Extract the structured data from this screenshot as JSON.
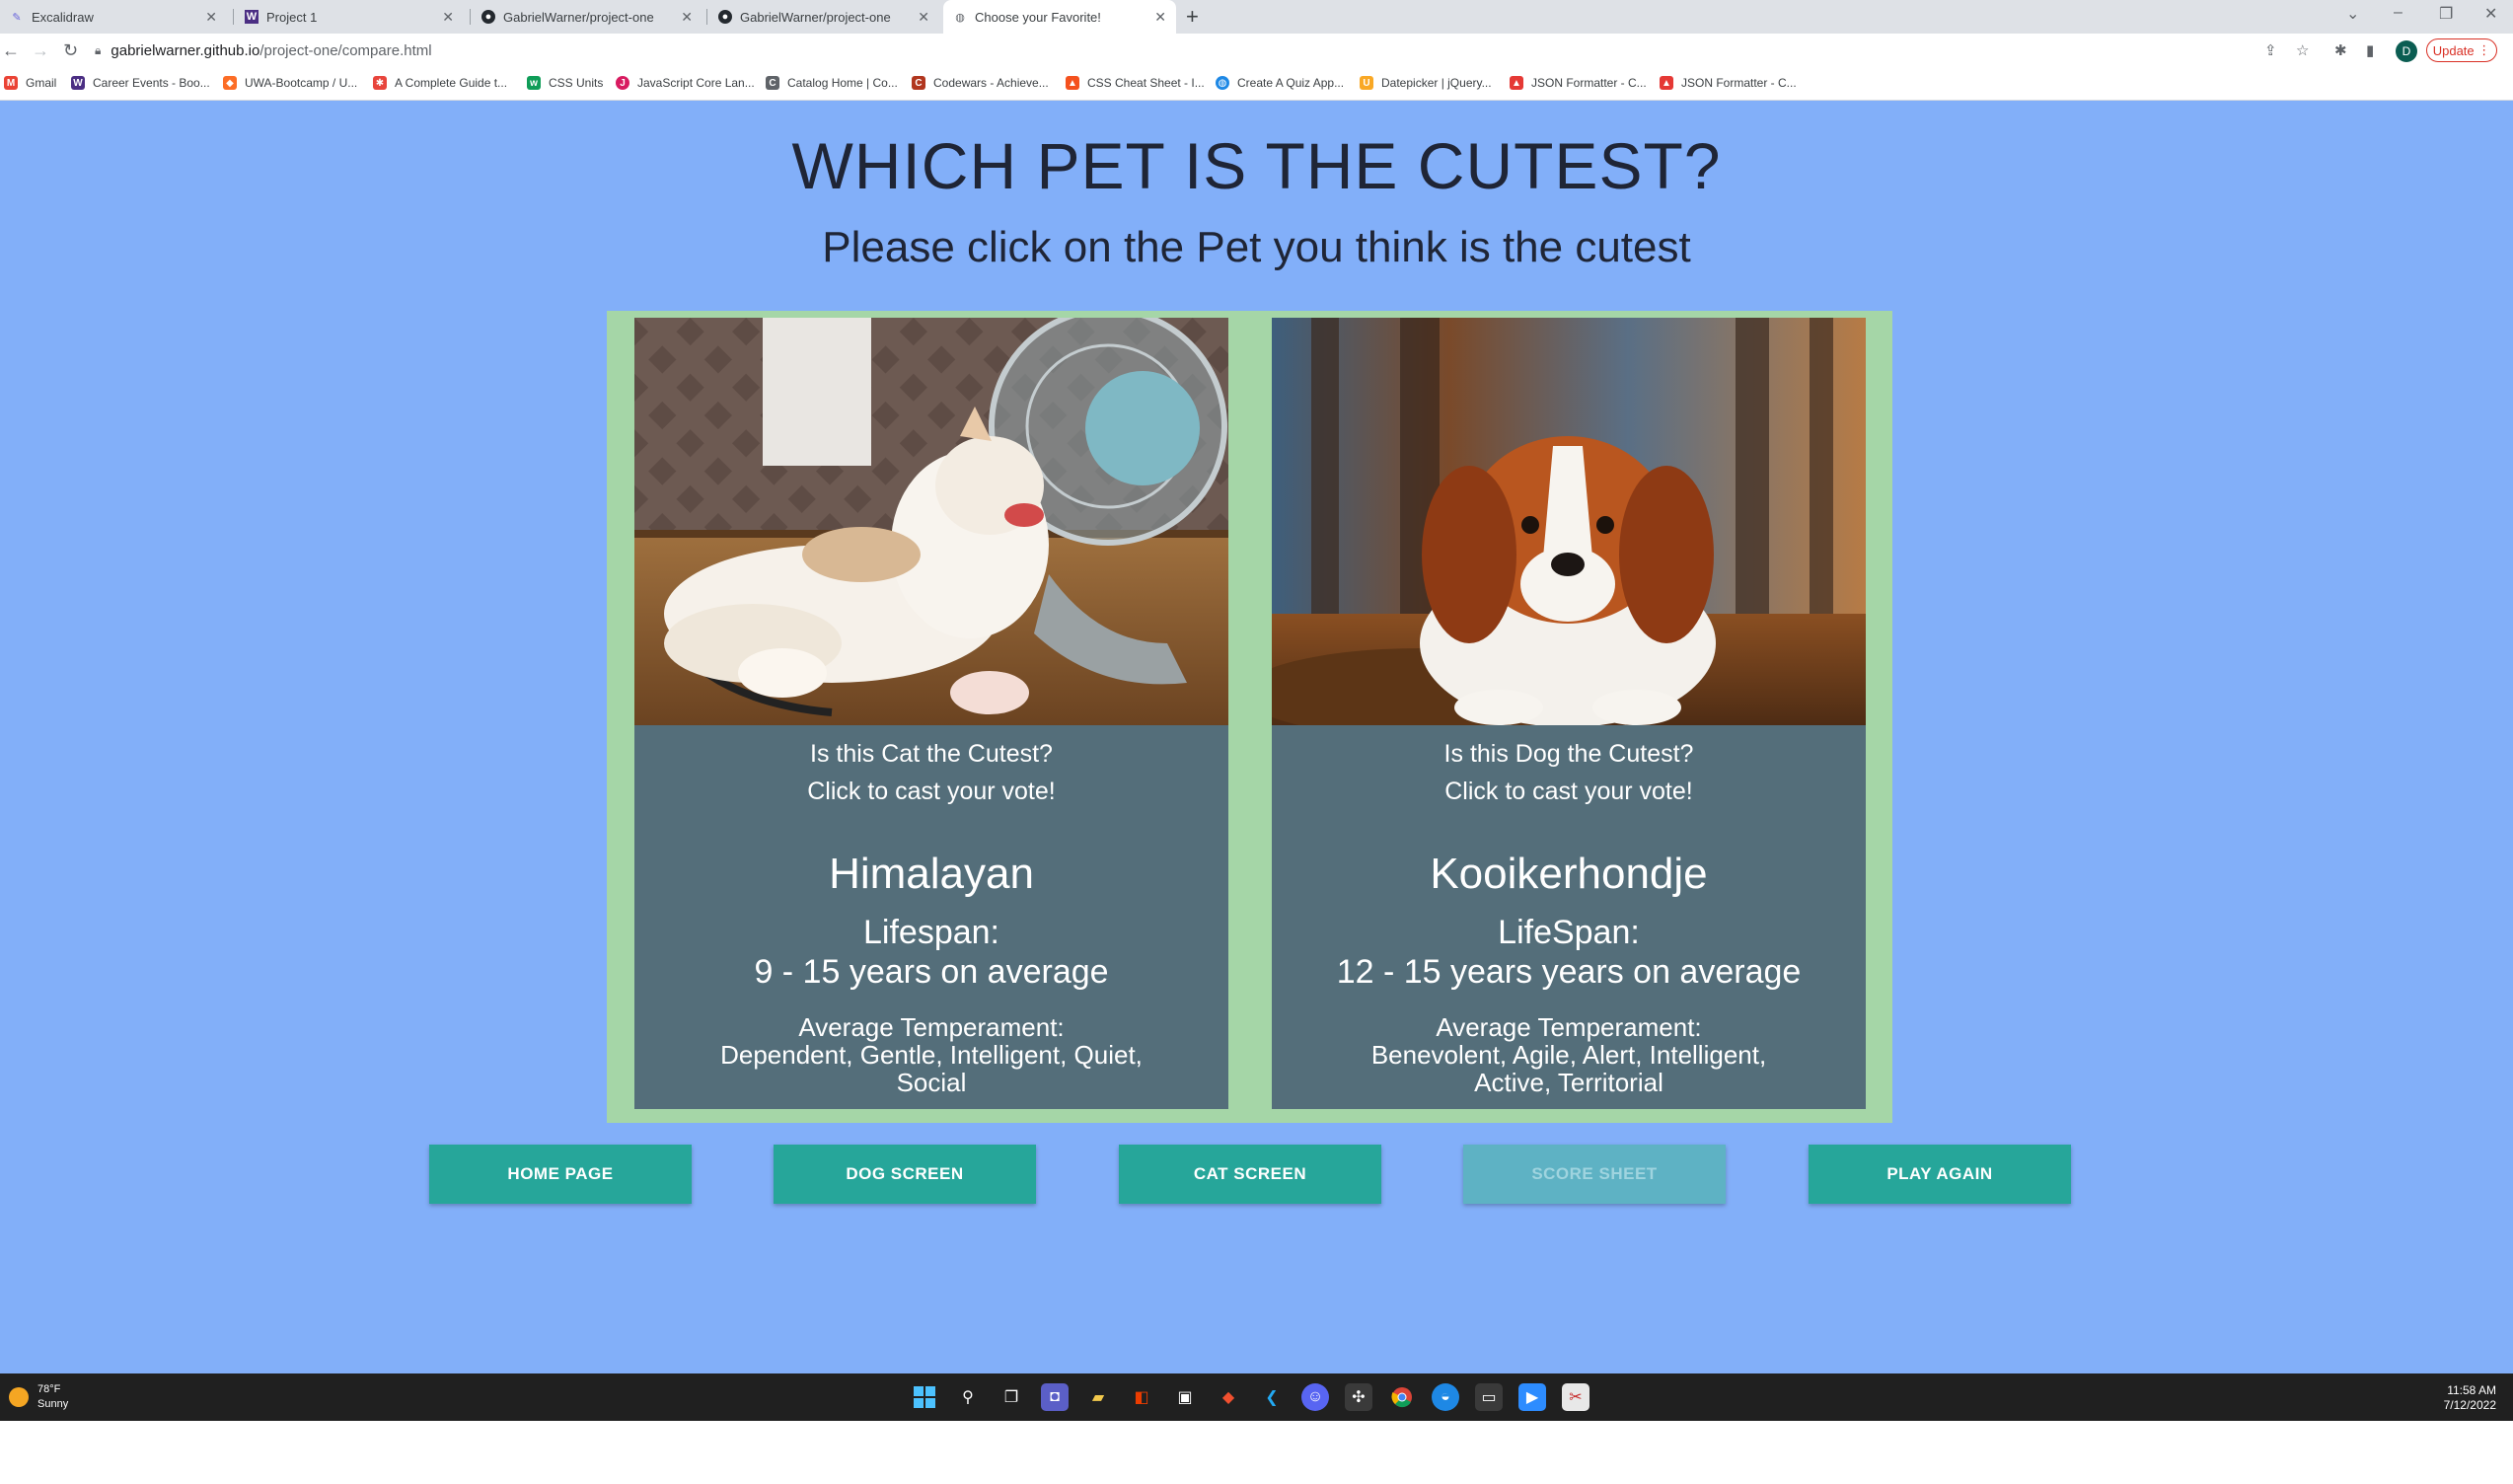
{
  "browser": {
    "tabs": [
      {
        "title": "Excalidraw",
        "icon": "excalidraw-icon",
        "active": false
      },
      {
        "title": "Project 1",
        "icon": "w-icon",
        "active": false
      },
      {
        "title": "GabrielWarner/project-one",
        "icon": "github-icon",
        "active": false
      },
      {
        "title": "GabrielWarner/project-one",
        "icon": "github-icon",
        "active": false
      },
      {
        "title": "Choose your Favorite!",
        "icon": "globe-icon",
        "active": true
      }
    ],
    "url_domain": "gabrielwarner.github.io",
    "url_path": "/project-one/compare.html",
    "avatar_letter": "D",
    "update_label": "Update",
    "bookmarks": [
      {
        "label": "Gmail",
        "color": "#ea4335"
      },
      {
        "label": "Career Events - Boo...",
        "color": "#4b2e83"
      },
      {
        "label": "UWA-Bootcamp / U...",
        "color": "#fc6d26"
      },
      {
        "label": "A Complete Guide t...",
        "color": "#e8453c"
      },
      {
        "label": "CSS Units",
        "color": "#0f9d58"
      },
      {
        "label": "JavaScript Core Lan...",
        "color": "#d81b60"
      },
      {
        "label": "Catalog Home | Co...",
        "color": "#5f6368"
      },
      {
        "label": "Codewars - Achieve...",
        "color": "#b1361e"
      },
      {
        "label": "CSS Cheat Sheet - I...",
        "color": "#f4511e"
      },
      {
        "label": "Create A Quiz App...",
        "color": "#1e88e5"
      },
      {
        "label": "Datepicker | jQuery...",
        "color": "#f9a825"
      },
      {
        "label": "JSON Formatter - C...",
        "color": "#e53935"
      },
      {
        "label": "JSON Formatter - C...",
        "color": "#e53935"
      }
    ]
  },
  "page": {
    "title": "WHICH PET IS THE CUTEST?",
    "subtitle": "Please click on the Pet you think is the cutest",
    "background": "#82aff9",
    "cat": {
      "question": "Is this Cat the Cutest?",
      "cta": "Click to cast your vote!",
      "breed": "Himalayan",
      "lifespan_label": "Lifespan:",
      "lifespan_value": "9 - 15 years on average",
      "temperament_label": "Average Temperament:",
      "temperament_value": "Dependent, Gentle, Intelligent, Quiet, Social"
    },
    "dog": {
      "question": "Is this Dog the Cutest?",
      "cta": "Click to cast your vote!",
      "breed": "Kooikerhondje",
      "lifespan_label": "LifeSpan:",
      "lifespan_value": "12 - 15 years years on average",
      "temperament_label": "Average Temperament:",
      "temperament_value": "Benevolent, Agile, Alert, Intelligent, Active, Territorial"
    },
    "buttons": [
      {
        "label": "HOME PAGE",
        "enabled": true
      },
      {
        "label": "DOG SCREEN",
        "enabled": true
      },
      {
        "label": "CAT SCREEN",
        "enabled": true
      },
      {
        "label": "SCORE SHEET",
        "enabled": false
      },
      {
        "label": "PLAY AGAIN",
        "enabled": true
      }
    ]
  },
  "taskbar": {
    "temperature": "78°F",
    "condition": "Sunny",
    "time": "11:58 AM",
    "date": "7/12/2022"
  }
}
